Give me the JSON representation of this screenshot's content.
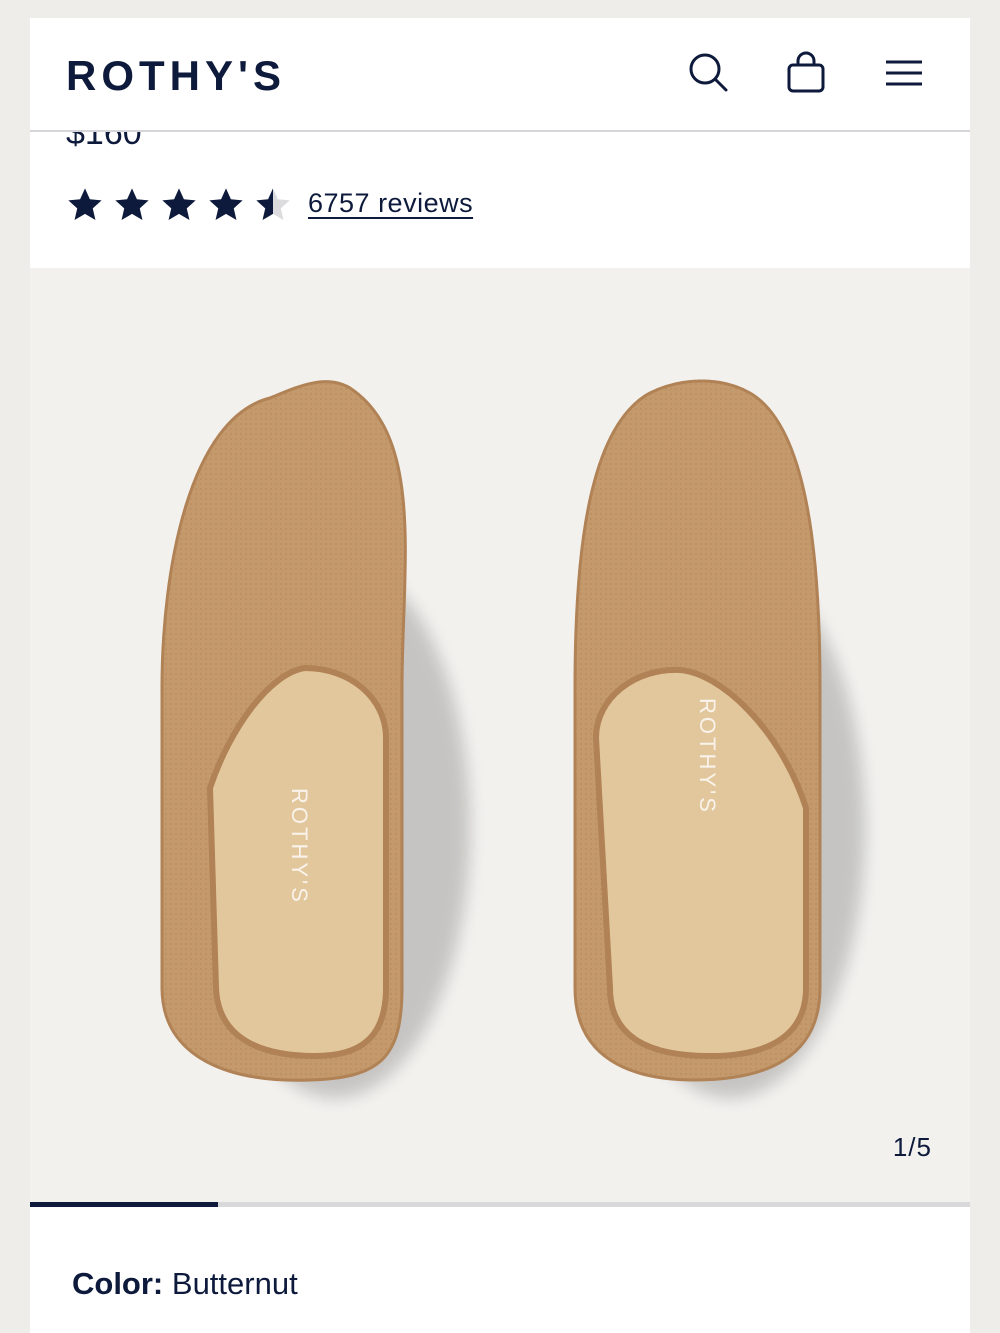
{
  "brand": {
    "logo_text": "ROTHY'S"
  },
  "header": {
    "icons": [
      "search-icon",
      "bag-icon",
      "menu-icon"
    ]
  },
  "product": {
    "price": "$160",
    "rating": 4.5,
    "rating_max": 5,
    "reviews_label": "6757 reviews"
  },
  "gallery": {
    "counter": "1/5",
    "current_index": 1,
    "total": 5,
    "progress_fraction": 0.2,
    "insole_text": "ROTHY'S"
  },
  "color_selector": {
    "label": "Color:",
    "value": "Butternut"
  },
  "colors": {
    "navy": "#0d1a3b",
    "shoe_knit": "#c49a6c",
    "insole": "#e2c79c",
    "gallery_bg": "#f2f1ee"
  }
}
